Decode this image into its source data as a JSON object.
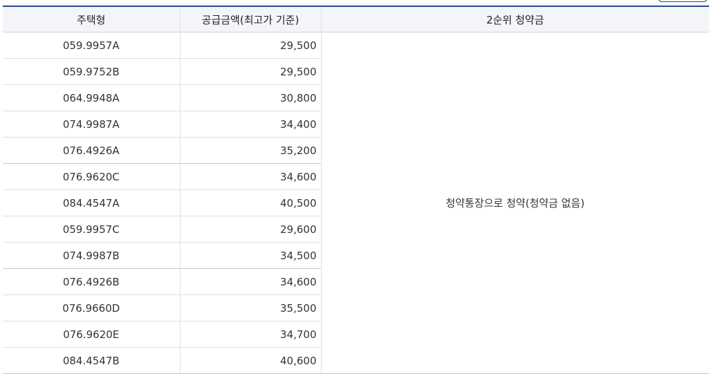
{
  "table": {
    "headers": {
      "type": "주택형",
      "price": "공급금액(최고가 기준)",
      "deposit": "2순위 청약금"
    },
    "deposit_note": "청약통장으로 청약(청약금 없음)",
    "rows": [
      {
        "type": "059.9957A",
        "price": "29,500"
      },
      {
        "type": "059.9752B",
        "price": "29,500"
      },
      {
        "type": "064.9948A",
        "price": "30,800"
      },
      {
        "type": "074.9987A",
        "price": "34,400"
      },
      {
        "type": "076.4926A",
        "price": "35,200"
      },
      {
        "type": "076.9620C",
        "price": "34,600"
      },
      {
        "type": "084.4547A",
        "price": "40,500"
      },
      {
        "type": "059.9957C",
        "price": "29,600"
      },
      {
        "type": "074.9987B",
        "price": "34,500"
      },
      {
        "type": "076.4926B",
        "price": "34,600"
      },
      {
        "type": "076.9660D",
        "price": "35,500"
      },
      {
        "type": "076.9620E",
        "price": "34,700"
      },
      {
        "type": "084.4547B",
        "price": "40,600"
      }
    ]
  }
}
